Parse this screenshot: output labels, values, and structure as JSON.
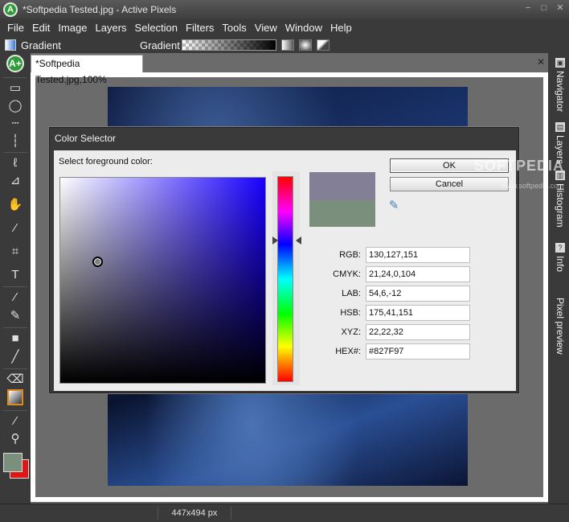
{
  "window": {
    "title": "*Softpedia Tested.jpg - Active Pixels"
  },
  "app_icon_letter": "A",
  "window_controls": {
    "minimize": "−",
    "maximize": "□",
    "close": "✕"
  },
  "menu": [
    "File",
    "Edit",
    "Image",
    "Layers",
    "Selection",
    "Filters",
    "Tools",
    "View",
    "Window",
    "Help"
  ],
  "options": {
    "tool_name": "Gradient",
    "gradient_label": "Gradient"
  },
  "tools": {
    "logo": "A+",
    "rect_select": "▭",
    "ellipse_select": "◯",
    "row_select": "┄",
    "col_select": "┆",
    "lasso": "ℓ",
    "poly_lasso": "⊿",
    "hand": "✋",
    "magic_wand": "⁄",
    "crop": "⌗",
    "text": "T",
    "brush": "⁄",
    "pencil": "✎",
    "rect_shape": "■",
    "line": "╱",
    "eraser": "⌫",
    "eyedropper": "⁄",
    "zoom": "⚲"
  },
  "document": {
    "tab_label": "*Softpedia Tested.jpg,100%",
    "close": "✕"
  },
  "dock": [
    {
      "label": "Navigator",
      "icon": "▣"
    },
    {
      "label": "Layers",
      "icon": "▤"
    },
    {
      "label": "Histogram",
      "icon": "▥"
    },
    {
      "label": "Info",
      "icon": "?"
    },
    {
      "label": "Pixel preview",
      "icon": ""
    }
  ],
  "status": {
    "dimensions": "447x494 px"
  },
  "watermark": {
    "big": "SOFTPEDIA",
    "small": "www.softpedia.com"
  },
  "dialog": {
    "title": "Color Selector",
    "prompt": "Select foreground color:",
    "ok": "OK",
    "cancel": "Cancel",
    "fields": [
      {
        "label": "RGB:",
        "value": "130,127,151"
      },
      {
        "label": "CMYK:",
        "value": "21,24,0,104"
      },
      {
        "label": "LAB:",
        "value": "54,6,-12"
      },
      {
        "label": "HSB:",
        "value": "175,41,151"
      },
      {
        "label": "XYZ:",
        "value": "22,22,32"
      },
      {
        "label": "HEX#:",
        "value": "#827F97"
      }
    ]
  },
  "colors": {
    "new_color": "#827F97",
    "old_color": "#7a907d",
    "background_color": "#e01515",
    "accent": "#2f9e3a"
  }
}
